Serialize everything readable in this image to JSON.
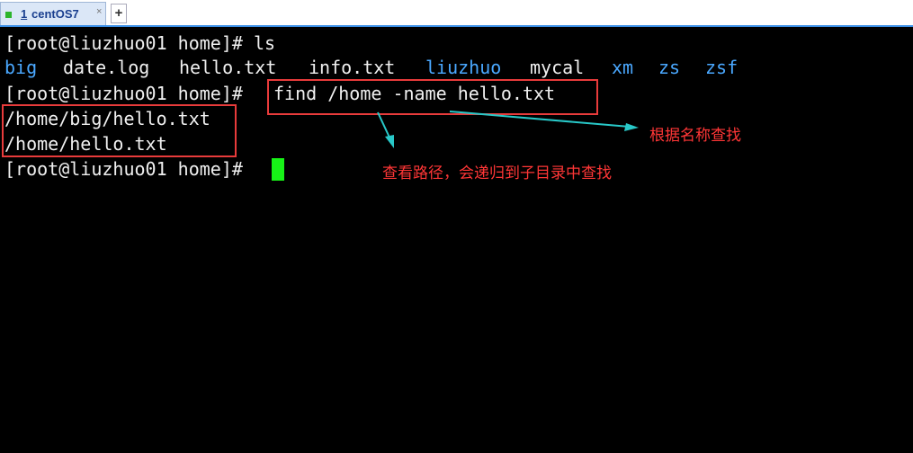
{
  "tabbar": {
    "tab": {
      "number": "1",
      "name": "centOS7",
      "close": "×"
    },
    "new_tab": "+"
  },
  "terminal": {
    "line1": "[root@liuzhuo01 home]# ls",
    "ls_output": [
      {
        "text": "big",
        "type": "dir"
      },
      {
        "text": "date.log",
        "type": "file"
      },
      {
        "text": "hello.txt",
        "type": "file"
      },
      {
        "text": "info.txt",
        "type": "file"
      },
      {
        "text": "liuzhuo",
        "type": "dir"
      },
      {
        "text": "mycal",
        "type": "file"
      },
      {
        "text": "xm",
        "type": "dir"
      },
      {
        "text": "zs",
        "type": "dir"
      },
      {
        "text": "zsf",
        "type": "dir"
      }
    ],
    "prompt": "[root@liuzhuo01 home]#",
    "find_command": "find /home -name hello.txt",
    "result1": "/home/big/hello.txt",
    "result2": "/home/hello.txt",
    "last_prompt": "[root@liuzhuo01 home]#"
  },
  "annotations": {
    "by_name": "根据名称查找",
    "search_path": "查看路径，会递归到子目录中查找"
  },
  "colors": {
    "background": "#000000",
    "text": "#f0f0f0",
    "directory": "#4aa8ff",
    "cursor": "#17f317",
    "annotation": "#e83b3b",
    "arrow": "#28c8c8"
  }
}
